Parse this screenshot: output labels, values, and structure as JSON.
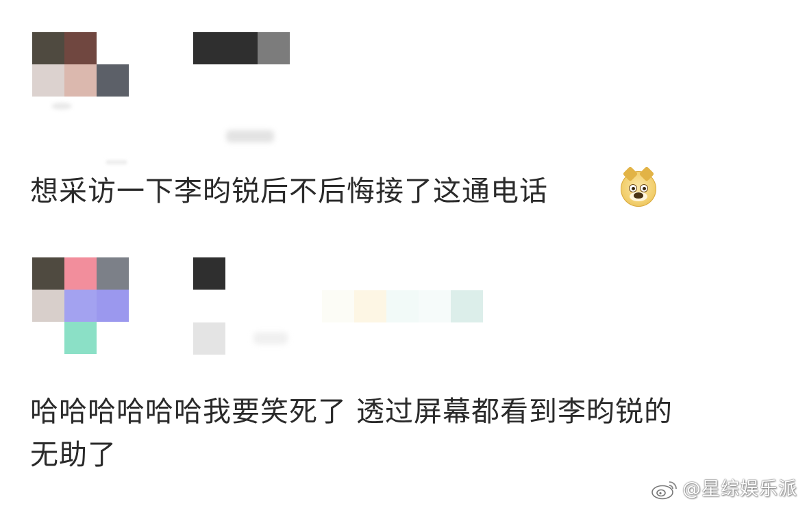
{
  "comments": [
    {
      "text": "想采访一下李昀锐后不后悔接了这通电话",
      "emoji": "doge-emoji"
    },
    {
      "text_line1": "哈哈哈哈哈哈我要笑死了 透过屏幕都看到李昀锐的",
      "text_line2": "无助了"
    }
  ],
  "watermark": {
    "text": "@星综娱乐派",
    "icon": "weibo-icon"
  },
  "colors": {
    "text": "#2a2a2a",
    "background": "#ffffff"
  }
}
